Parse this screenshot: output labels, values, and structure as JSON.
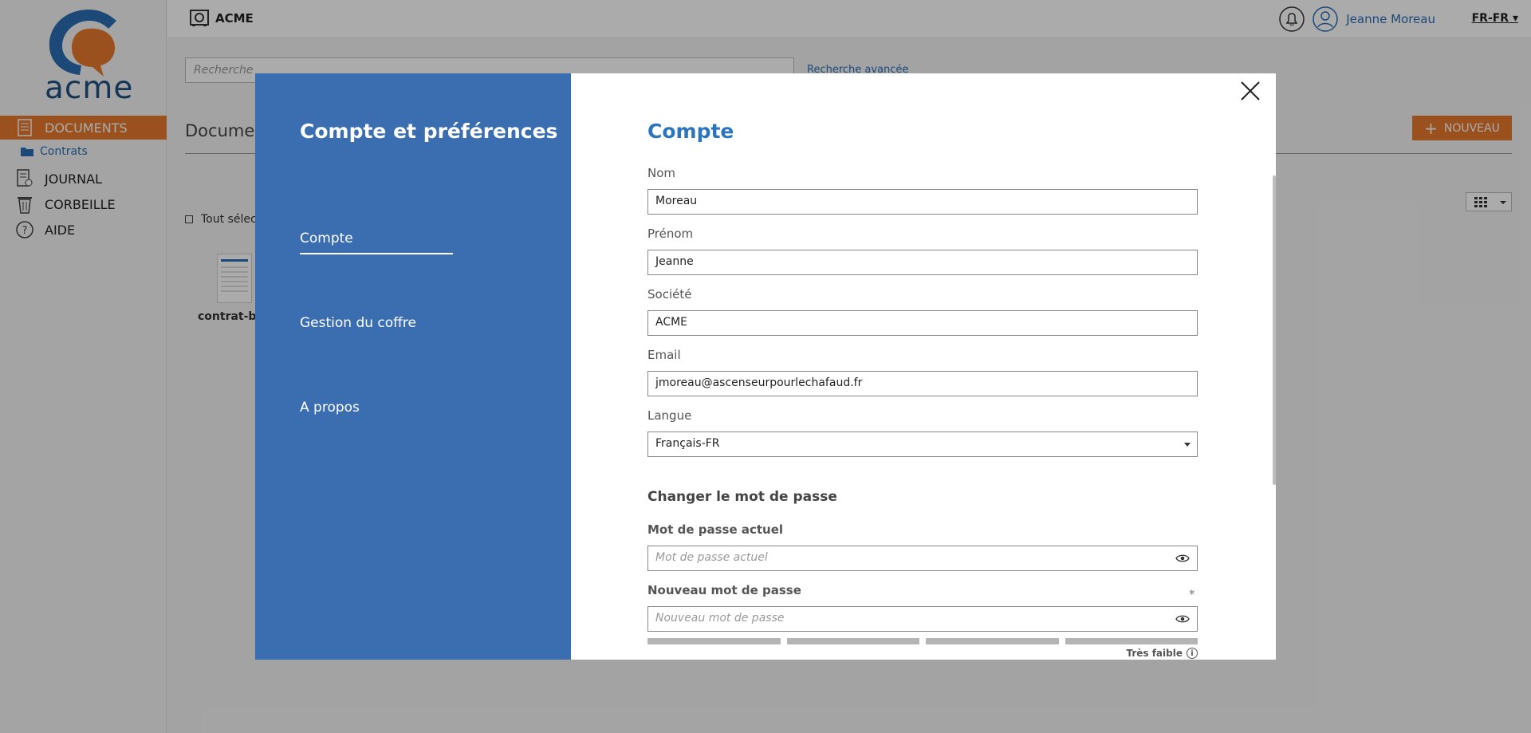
{
  "app": {
    "logo_text": "acme",
    "brand": "ACME",
    "user_name": "Jeanne Moreau",
    "lang": "FR-FR"
  },
  "sidebar": {
    "items": [
      {
        "label": "DOCUMENTS",
        "icon": "document-icon",
        "active": true
      },
      {
        "label": "JOURNAL",
        "icon": "journal-icon",
        "active": false
      },
      {
        "label": "CORBEILLE",
        "icon": "trash-icon",
        "active": false
      },
      {
        "label": "AIDE",
        "icon": "help-icon",
        "active": false
      }
    ],
    "sub_folder": "Contrats"
  },
  "main": {
    "search_placeholder": "Recherche",
    "advanced_search": "Recherche avancée",
    "heading": "Documen",
    "new_button": "NOUVEAU",
    "select_all": "Tout sélec",
    "doc_name": "contrat-ba"
  },
  "modal": {
    "title": "Compte et préférences",
    "nav": [
      {
        "label": "Compte",
        "active": true
      },
      {
        "label": "Gestion du coffre",
        "active": false
      },
      {
        "label": "A propos",
        "active": false
      }
    ],
    "section_title": "Compte",
    "fields": {
      "nom_label": "Nom",
      "nom_value": "Moreau",
      "prenom_label": "Prénom",
      "prenom_value": "Jeanne",
      "societe_label": "Société",
      "societe_value": "ACME",
      "email_label": "Email",
      "email_value": "jmoreau@ascenseurpourlechafaud.fr",
      "langue_label": "Langue",
      "langue_value": "Français-FR"
    },
    "password": {
      "title": "Changer le mot de passe",
      "current_label": "Mot de passe actuel",
      "current_placeholder": "Mot de passe actuel",
      "new_label": "Nouveau mot de passe",
      "new_placeholder": "Nouveau mot de passe",
      "required_mark": "*",
      "strength_label": "Très faible",
      "info": "i"
    }
  },
  "colors": {
    "accent_orange": "#e8792e",
    "modal_blue": "#3a6eb1",
    "title_blue": "#2a74c0"
  }
}
